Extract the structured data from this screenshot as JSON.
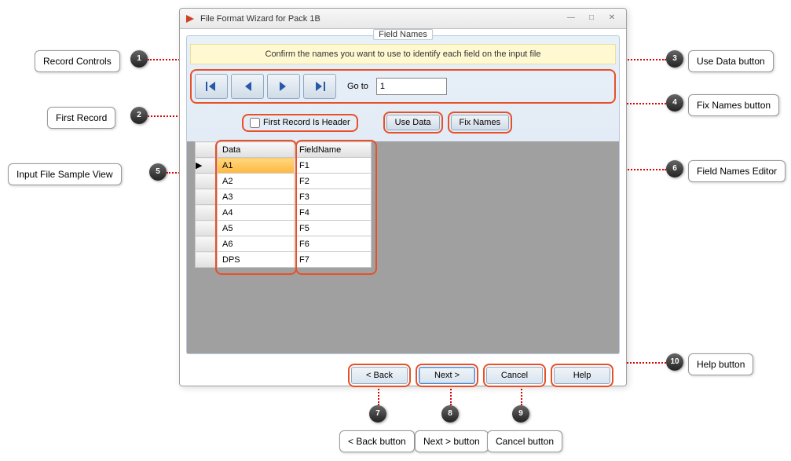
{
  "window_title": "File Format Wizard for Pack 1B",
  "fieldset_title": "Field Names",
  "instruction": "Confirm the names you want to use to identify each field on the input file",
  "goto_label": "Go to",
  "goto_value": "1",
  "first_record_label": "First Record Is Header",
  "use_data_label": "Use Data",
  "fix_names_label": "Fix Names",
  "columns": {
    "data": "Data",
    "field": "FieldName"
  },
  "rows": [
    {
      "data": "A1",
      "field": "F1"
    },
    {
      "data": "A2",
      "field": "F2"
    },
    {
      "data": "A3",
      "field": "F3"
    },
    {
      "data": "A4",
      "field": "F4"
    },
    {
      "data": "A5",
      "field": "F5"
    },
    {
      "data": "A6",
      "field": "F6"
    },
    {
      "data": "DPS",
      "field": "F7"
    }
  ],
  "buttons": {
    "back": "< Back",
    "next": "Next >",
    "cancel": "Cancel",
    "help": "Help"
  },
  "callouts": {
    "1": "Record Controls",
    "2": "First Record",
    "3": "Use Data button",
    "4": "Fix Names button",
    "5": "Input File Sample View",
    "6": "Field Names Editor",
    "7": "< Back button",
    "8": "Next > button",
    "9": "Cancel button",
    "10": "Help button"
  },
  "row_indicator": "▶"
}
